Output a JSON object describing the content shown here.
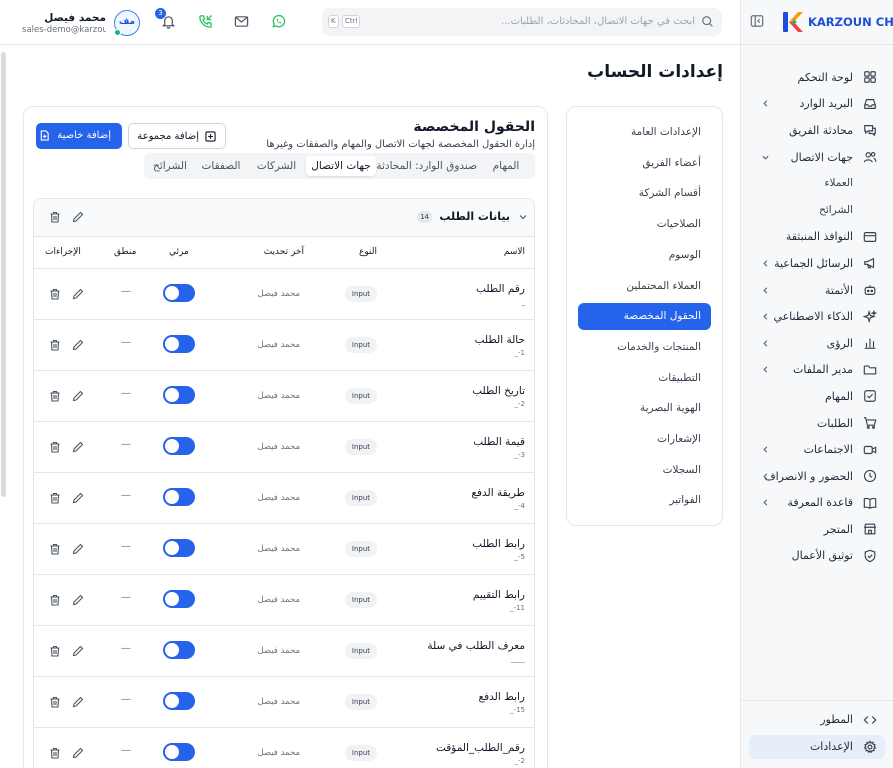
{
  "brand": {
    "name": "KARZOUN CHAT"
  },
  "search": {
    "placeholder": "ابحث في جهات الاتصال، المحادثات، الطلبات...",
    "kbd_k": "K",
    "kbd_ctrl": "Ctrl"
  },
  "notifications": {
    "count": "3"
  },
  "user": {
    "initials": "مف",
    "name": "محمد فيصل",
    "email": "sales-demo@karzoun..."
  },
  "sidebar": {
    "items": [
      {
        "label": "لوحة التحكم",
        "icon": "dashboard-icon"
      },
      {
        "label": "البريد الوارد",
        "icon": "inbox-icon",
        "chevron": "left"
      },
      {
        "label": "محادثة الفريق",
        "icon": "team-chat-icon"
      },
      {
        "label": "جهات الاتصال",
        "icon": "users-icon",
        "chevron": "down"
      },
      {
        "label": "العملاء",
        "sub": true
      },
      {
        "label": "الشرائح",
        "sub": true
      },
      {
        "label": "النوافذ المنبثقة",
        "icon": "popup-icon"
      },
      {
        "label": "الرسائل الجماعية",
        "icon": "megaphone-icon",
        "chevron": "left"
      },
      {
        "label": "الأتمتة",
        "icon": "bot-icon",
        "chevron": "left"
      },
      {
        "label": "الذكاء الاصطناعي",
        "icon": "sparkles-icon",
        "chevron": "left"
      },
      {
        "label": "الرؤى",
        "icon": "chart-icon",
        "chevron": "left"
      },
      {
        "label": "مدير الملفات",
        "icon": "folder-icon",
        "chevron": "left"
      },
      {
        "label": "المهام",
        "icon": "check-square-icon"
      },
      {
        "label": "الطلبات",
        "icon": "cart-icon"
      },
      {
        "label": "الاجتماعات",
        "icon": "video-icon",
        "chevron": "left"
      },
      {
        "label": "الحضور و الانصراف",
        "icon": "clock-icon",
        "chevron": "left"
      },
      {
        "label": "قاعدة المعرفة",
        "icon": "book-icon",
        "chevron": "left"
      },
      {
        "label": "المتجر",
        "icon": "store-icon"
      },
      {
        "label": "توثيق الأعمال",
        "icon": "shield-check-icon"
      }
    ],
    "developer": "المطور",
    "settings": "الإعدادات"
  },
  "page": {
    "title": "إعدادات الحساب"
  },
  "settings_menu": [
    "الإعدادات العامة",
    "أعضاء الفريق",
    "أقسام الشركة",
    "الصلاحيات",
    "الوسوم",
    "العملاء المحتملين",
    "الحقول المخصصة",
    "المنتجات والخدمات",
    "التطبيقات",
    "الهوية البصرية",
    "الإشعارات",
    "السجلات",
    "الفواتير"
  ],
  "custom_fields": {
    "title": "الحقول المخصصة",
    "description": "إدارة الحقول المخصصة لجهات الاتصال والمهام والصفقات وغيرها",
    "add_property": "إضافة خاصية",
    "add_group": "إضافة مجموعة",
    "tabs": [
      "المهام",
      "صندوق الوارد: المحادثة",
      "جهات الاتصال",
      "الشركات",
      "الصفقات",
      "الشرائح"
    ],
    "active_tab": 2,
    "group": {
      "name": "بيانات الطلب",
      "count": "14",
      "columns": {
        "name": "الاسم",
        "type": "النوع",
        "updated": "آخر تحديث",
        "flexible": "مرئي",
        "logic": "منطق",
        "actions": "الإجراءات"
      },
      "rows": [
        {
          "name": "رقم الطلب",
          "key": "_",
          "type": "Input",
          "updated_by": "محمد فيصل",
          "logic": "—"
        },
        {
          "name": "حالة الطلب",
          "key": "_-1",
          "type": "Input",
          "updated_by": "محمد فيصل",
          "logic": "—"
        },
        {
          "name": "تاريخ الطلب",
          "key": "_-2",
          "type": "Input",
          "updated_by": "محمد فيصل",
          "logic": "—"
        },
        {
          "name": "قيمة الطلب",
          "key": "_-3",
          "type": "Input",
          "updated_by": "محمد فيصل",
          "logic": "—"
        },
        {
          "name": "طريقة الدفع",
          "key": "_-4",
          "type": "Input",
          "updated_by": "محمد فيصل",
          "logic": "—"
        },
        {
          "name": "رابط الطلب",
          "key": "_-5",
          "type": "Input",
          "updated_by": "محمد فيصل",
          "logic": "—"
        },
        {
          "name": "رابط التقييم",
          "key": "_-11",
          "type": "Input",
          "updated_by": "محمد فيصل",
          "logic": "—"
        },
        {
          "name": "معرف الطلب في سلة",
          "key": "____",
          "type": "Input",
          "updated_by": "محمد فيصل",
          "logic": "—"
        },
        {
          "name": "رابط الدفع",
          "key": "_-15",
          "type": "Input",
          "updated_by": "محمد فيصل",
          "logic": "—"
        },
        {
          "name": "رقم_الطلب_المؤقت",
          "key": "_-2",
          "type": "Input",
          "updated_by": "محمد فيصل",
          "logic": "—"
        }
      ]
    }
  },
  "colors": {
    "accent": "#2563eb",
    "brand": "#1d4ed8",
    "online": "#10b981"
  }
}
